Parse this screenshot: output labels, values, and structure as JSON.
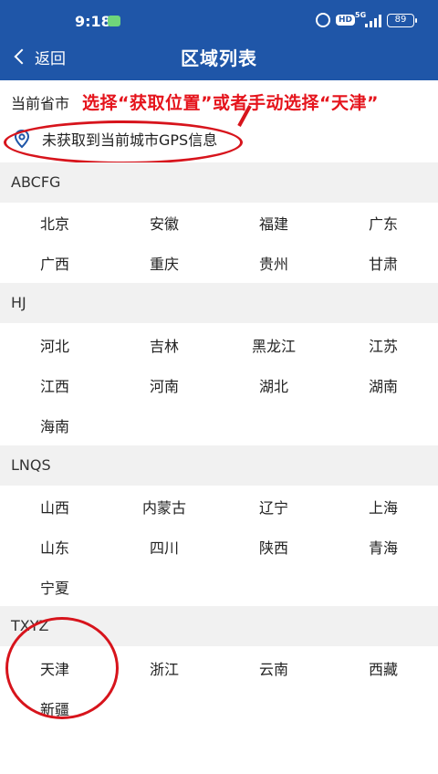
{
  "status_bar": {
    "time": "9:18",
    "network": "5G",
    "battery": "89",
    "hd": "HD"
  },
  "nav": {
    "back_label": "返回",
    "title": "区域列表"
  },
  "current_province_label": "当前省市",
  "annotation": "选择“获取位置”或者手动选择“天津”",
  "gps_label": "未获取到当前城市GPS信息",
  "sections": [
    {
      "header": "ABCFG",
      "cities": [
        "北京",
        "安徽",
        "福建",
        "广东",
        "广西",
        "重庆",
        "贵州",
        "甘肃"
      ]
    },
    {
      "header": "HJ",
      "cities": [
        "河北",
        "吉林",
        "黑龙江",
        "江苏",
        "江西",
        "河南",
        "湖北",
        "湖南",
        "海南"
      ]
    },
    {
      "header": "LNQS",
      "cities": [
        "山西",
        "内蒙古",
        "辽宁",
        "上海",
        "山东",
        "四川",
        "陕西",
        "青海",
        "宁夏"
      ]
    },
    {
      "header": "TXYZ",
      "cities": [
        "天津",
        "浙江",
        "云南",
        "西藏",
        "新疆"
      ]
    }
  ],
  "colors": {
    "header_bg": "#1f56a8",
    "annotation_red": "#e5141c",
    "section_bg": "#f1f1f1"
  }
}
